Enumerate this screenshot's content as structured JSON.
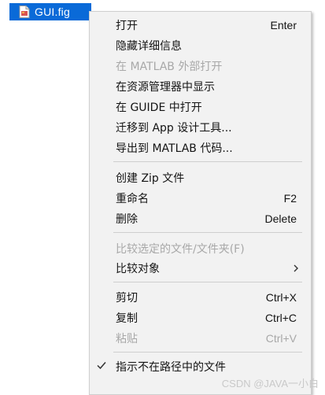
{
  "file": {
    "name": "GUI.fig",
    "icon": "fig-file-icon"
  },
  "menu": {
    "items": [
      {
        "label": "打开",
        "shortcut": "Enter",
        "disabled": false
      },
      {
        "label": "隐藏详细信息",
        "shortcut": "",
        "disabled": false
      },
      {
        "label": "在 MATLAB 外部打开",
        "shortcut": "",
        "disabled": true
      },
      {
        "label": "在资源管理器中显示",
        "shortcut": "",
        "disabled": false
      },
      {
        "label": "在 GUIDE 中打开",
        "shortcut": "",
        "disabled": false
      },
      {
        "label": "迁移到 App 设计工具...",
        "shortcut": "",
        "disabled": false
      },
      {
        "label": "导出到 MATLAB 代码...",
        "shortcut": "",
        "disabled": false
      },
      {
        "label": "创建 Zip 文件",
        "shortcut": "",
        "disabled": false
      },
      {
        "label": "重命名",
        "shortcut": "F2",
        "disabled": false
      },
      {
        "label": "删除",
        "shortcut": "Delete",
        "disabled": false
      },
      {
        "label": "比较选定的文件/文件夹(F)",
        "shortcut": "",
        "disabled": true
      },
      {
        "label": "比较对象",
        "shortcut": "",
        "disabled": false,
        "submenu": true
      },
      {
        "label": "剪切",
        "shortcut": "Ctrl+X",
        "disabled": false
      },
      {
        "label": "复制",
        "shortcut": "Ctrl+C",
        "disabled": false
      },
      {
        "label": "粘贴",
        "shortcut": "Ctrl+V",
        "disabled": true
      },
      {
        "label": "指示不在路径中的文件",
        "shortcut": "",
        "disabled": false,
        "checked": true
      }
    ]
  },
  "watermark": "CSDN @JAVA一小白",
  "colors": {
    "selection": "#0a6ad8",
    "menu_bg": "#f2f2f2",
    "disabled_text": "#a8a8a8"
  }
}
